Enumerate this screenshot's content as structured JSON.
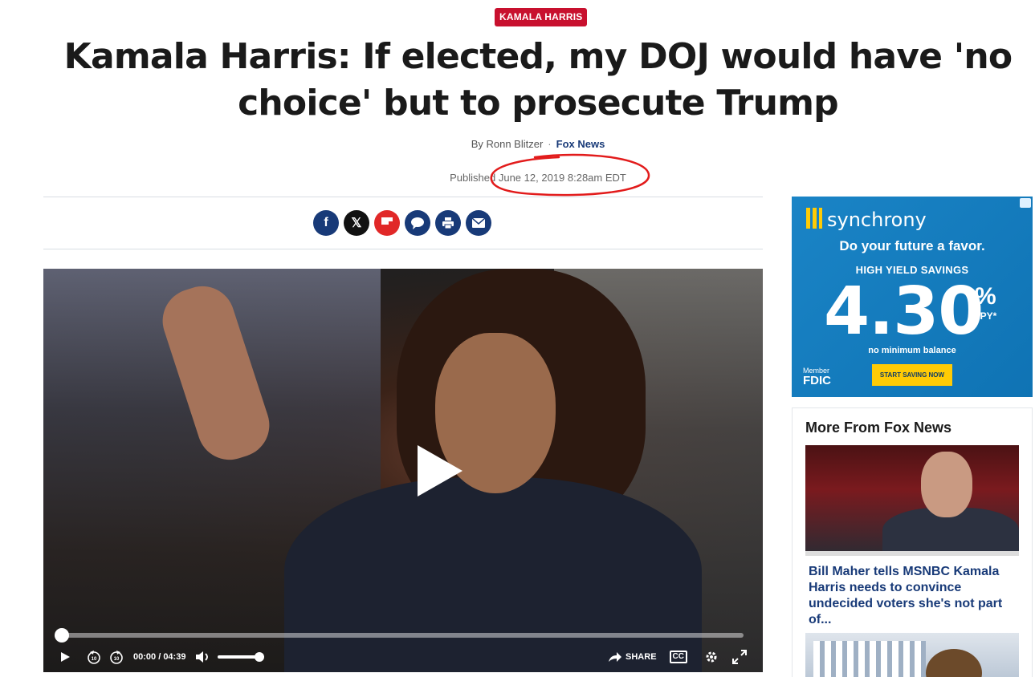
{
  "category_tag": "KAMALA HARRIS",
  "headline": "Kamala Harris: If elected, my DOJ would have 'no choice' but to prosecute Trump",
  "byline": {
    "author": "By Ronn Blitzer",
    "separator": "·",
    "source": "Fox News"
  },
  "published": "Published June 12, 2019 8:28am EDT",
  "share_buttons": [
    {
      "name": "facebook",
      "icon": "facebook-icon"
    },
    {
      "name": "x",
      "icon": "x-icon"
    },
    {
      "name": "flipboard",
      "icon": "flipboard-icon"
    },
    {
      "name": "comments",
      "icon": "comment-icon"
    },
    {
      "name": "print",
      "icon": "print-icon"
    },
    {
      "name": "email",
      "icon": "email-icon"
    }
  ],
  "video": {
    "current_time": "00:00",
    "duration": "04:39",
    "share_label": "SHARE",
    "cc_label": "CC",
    "progress": 0
  },
  "ad": {
    "brand": "synchrony",
    "tagline": "Do your future a favor.",
    "product": "HIGH YIELD SAVINGS",
    "rate": "4.30",
    "percent": "%",
    "apy": "APY*",
    "note": "no minimum balance",
    "member": "Member",
    "fdic": "FDIC",
    "cta": "START SAVING NOW"
  },
  "more_from": {
    "heading": "More From Fox News",
    "items": [
      {
        "title": "Bill Maher tells MSNBC Kamala Harris needs to convince undecided voters she's not part of..."
      }
    ]
  },
  "colors": {
    "accent_red": "#c8102e",
    "fox_navy": "#183a78",
    "ad_blue": "#1a84c6",
    "ad_yellow": "#ffcb05"
  }
}
